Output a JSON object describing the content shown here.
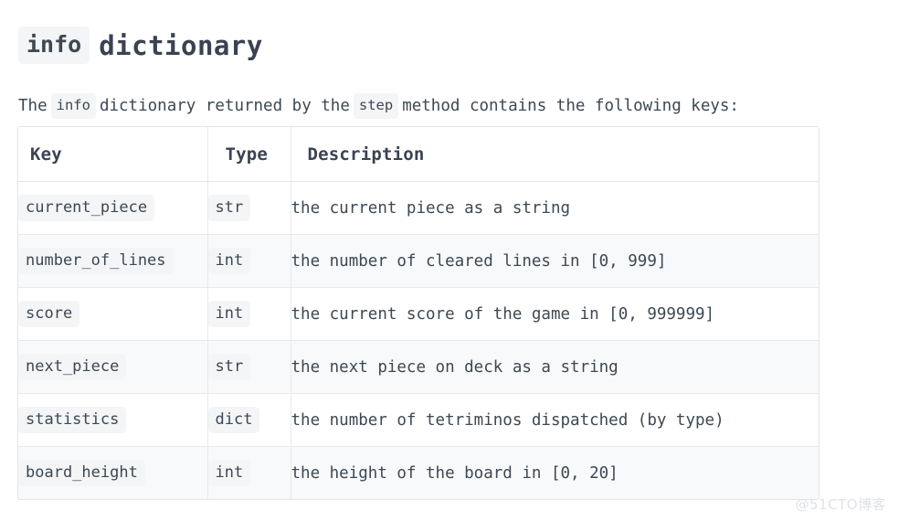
{
  "heading": {
    "code": "info",
    "word": "dictionary"
  },
  "intro": {
    "before": "The",
    "code1": "info",
    "middle": "dictionary returned by the",
    "code2": "step",
    "after": "method contains the following keys:"
  },
  "table": {
    "columns": [
      "Key",
      "Type",
      "Description"
    ],
    "rows": [
      {
        "key": "current_piece",
        "type": "str",
        "description": "the current piece as a string"
      },
      {
        "key": "number_of_lines",
        "type": "int",
        "description": "the number of cleared lines in [0, 999]"
      },
      {
        "key": "score",
        "type": "int",
        "description": "the current score of the game in [0, 999999]"
      },
      {
        "key": "next_piece",
        "type": "str",
        "description": "the next piece on deck as a string"
      },
      {
        "key": "statistics",
        "type": "dict",
        "description": "the number of tetriminos dispatched (by type)"
      },
      {
        "key": "board_height",
        "type": "int",
        "description": "the height of the board in [0, 20]"
      }
    ]
  },
  "watermark": {
    "text": "@51CTO博客"
  },
  "colors": {
    "text": "#3d4852",
    "heading": "#3b4252",
    "code_bg": "#f4f5f7",
    "row_stripe": "#f8f9fa",
    "border": "#e7e9ec",
    "watermark": "#dfe2e6"
  }
}
